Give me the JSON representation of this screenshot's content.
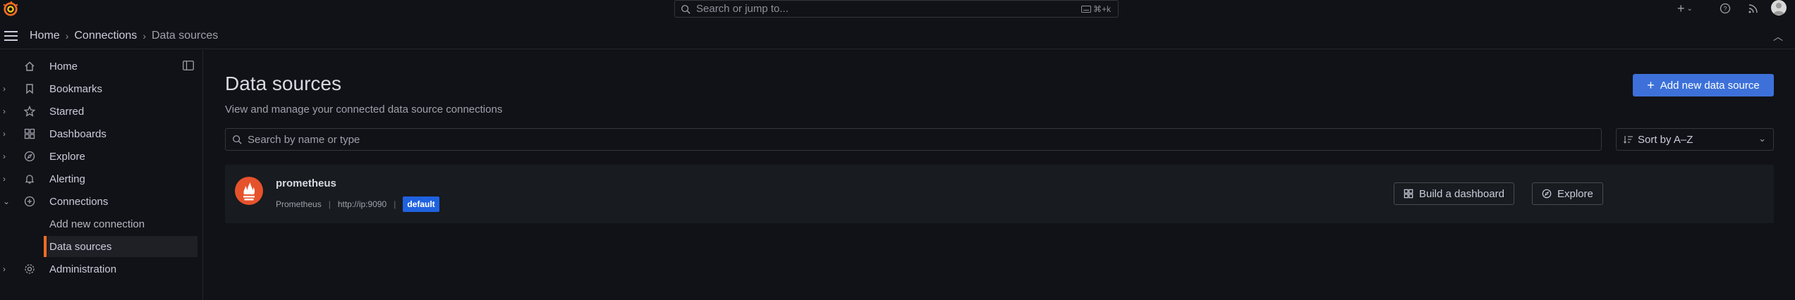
{
  "topbar": {
    "search_placeholder": "Search or jump to...",
    "search_shortcut": "⌘+k"
  },
  "breadcrumb": [
    "Home",
    "Connections",
    "Data sources"
  ],
  "sidebar": {
    "items": [
      {
        "label": "Home",
        "icon": "home-icon"
      },
      {
        "label": "Bookmarks",
        "icon": "bookmark-icon"
      },
      {
        "label": "Starred",
        "icon": "star-icon"
      },
      {
        "label": "Dashboards",
        "icon": "dashboards-icon"
      },
      {
        "label": "Explore",
        "icon": "compass-icon"
      },
      {
        "label": "Alerting",
        "icon": "bell-icon"
      },
      {
        "label": "Connections",
        "icon": "connections-icon"
      },
      {
        "label": "Administration",
        "icon": "gear-icon"
      }
    ],
    "sub_items": [
      {
        "label": "Add new connection"
      },
      {
        "label": "Data sources"
      }
    ]
  },
  "page": {
    "title": "Data sources",
    "subtitle": "View and manage your connected data source connections",
    "add_button": "Add new data source",
    "filter_placeholder": "Search by name or type",
    "sort_label": "Sort by A–Z"
  },
  "datasources": [
    {
      "name": "prometheus",
      "type": "Prometheus",
      "url": "http://ip:9090",
      "badge": "default",
      "build_button": "Build a dashboard",
      "explore_button": "Explore"
    }
  ],
  "colors": {
    "accent": "#f46b20",
    "primary": "#3d71d9",
    "badge": "#1f62e0",
    "background": "#111217",
    "card": "#181b1f"
  }
}
